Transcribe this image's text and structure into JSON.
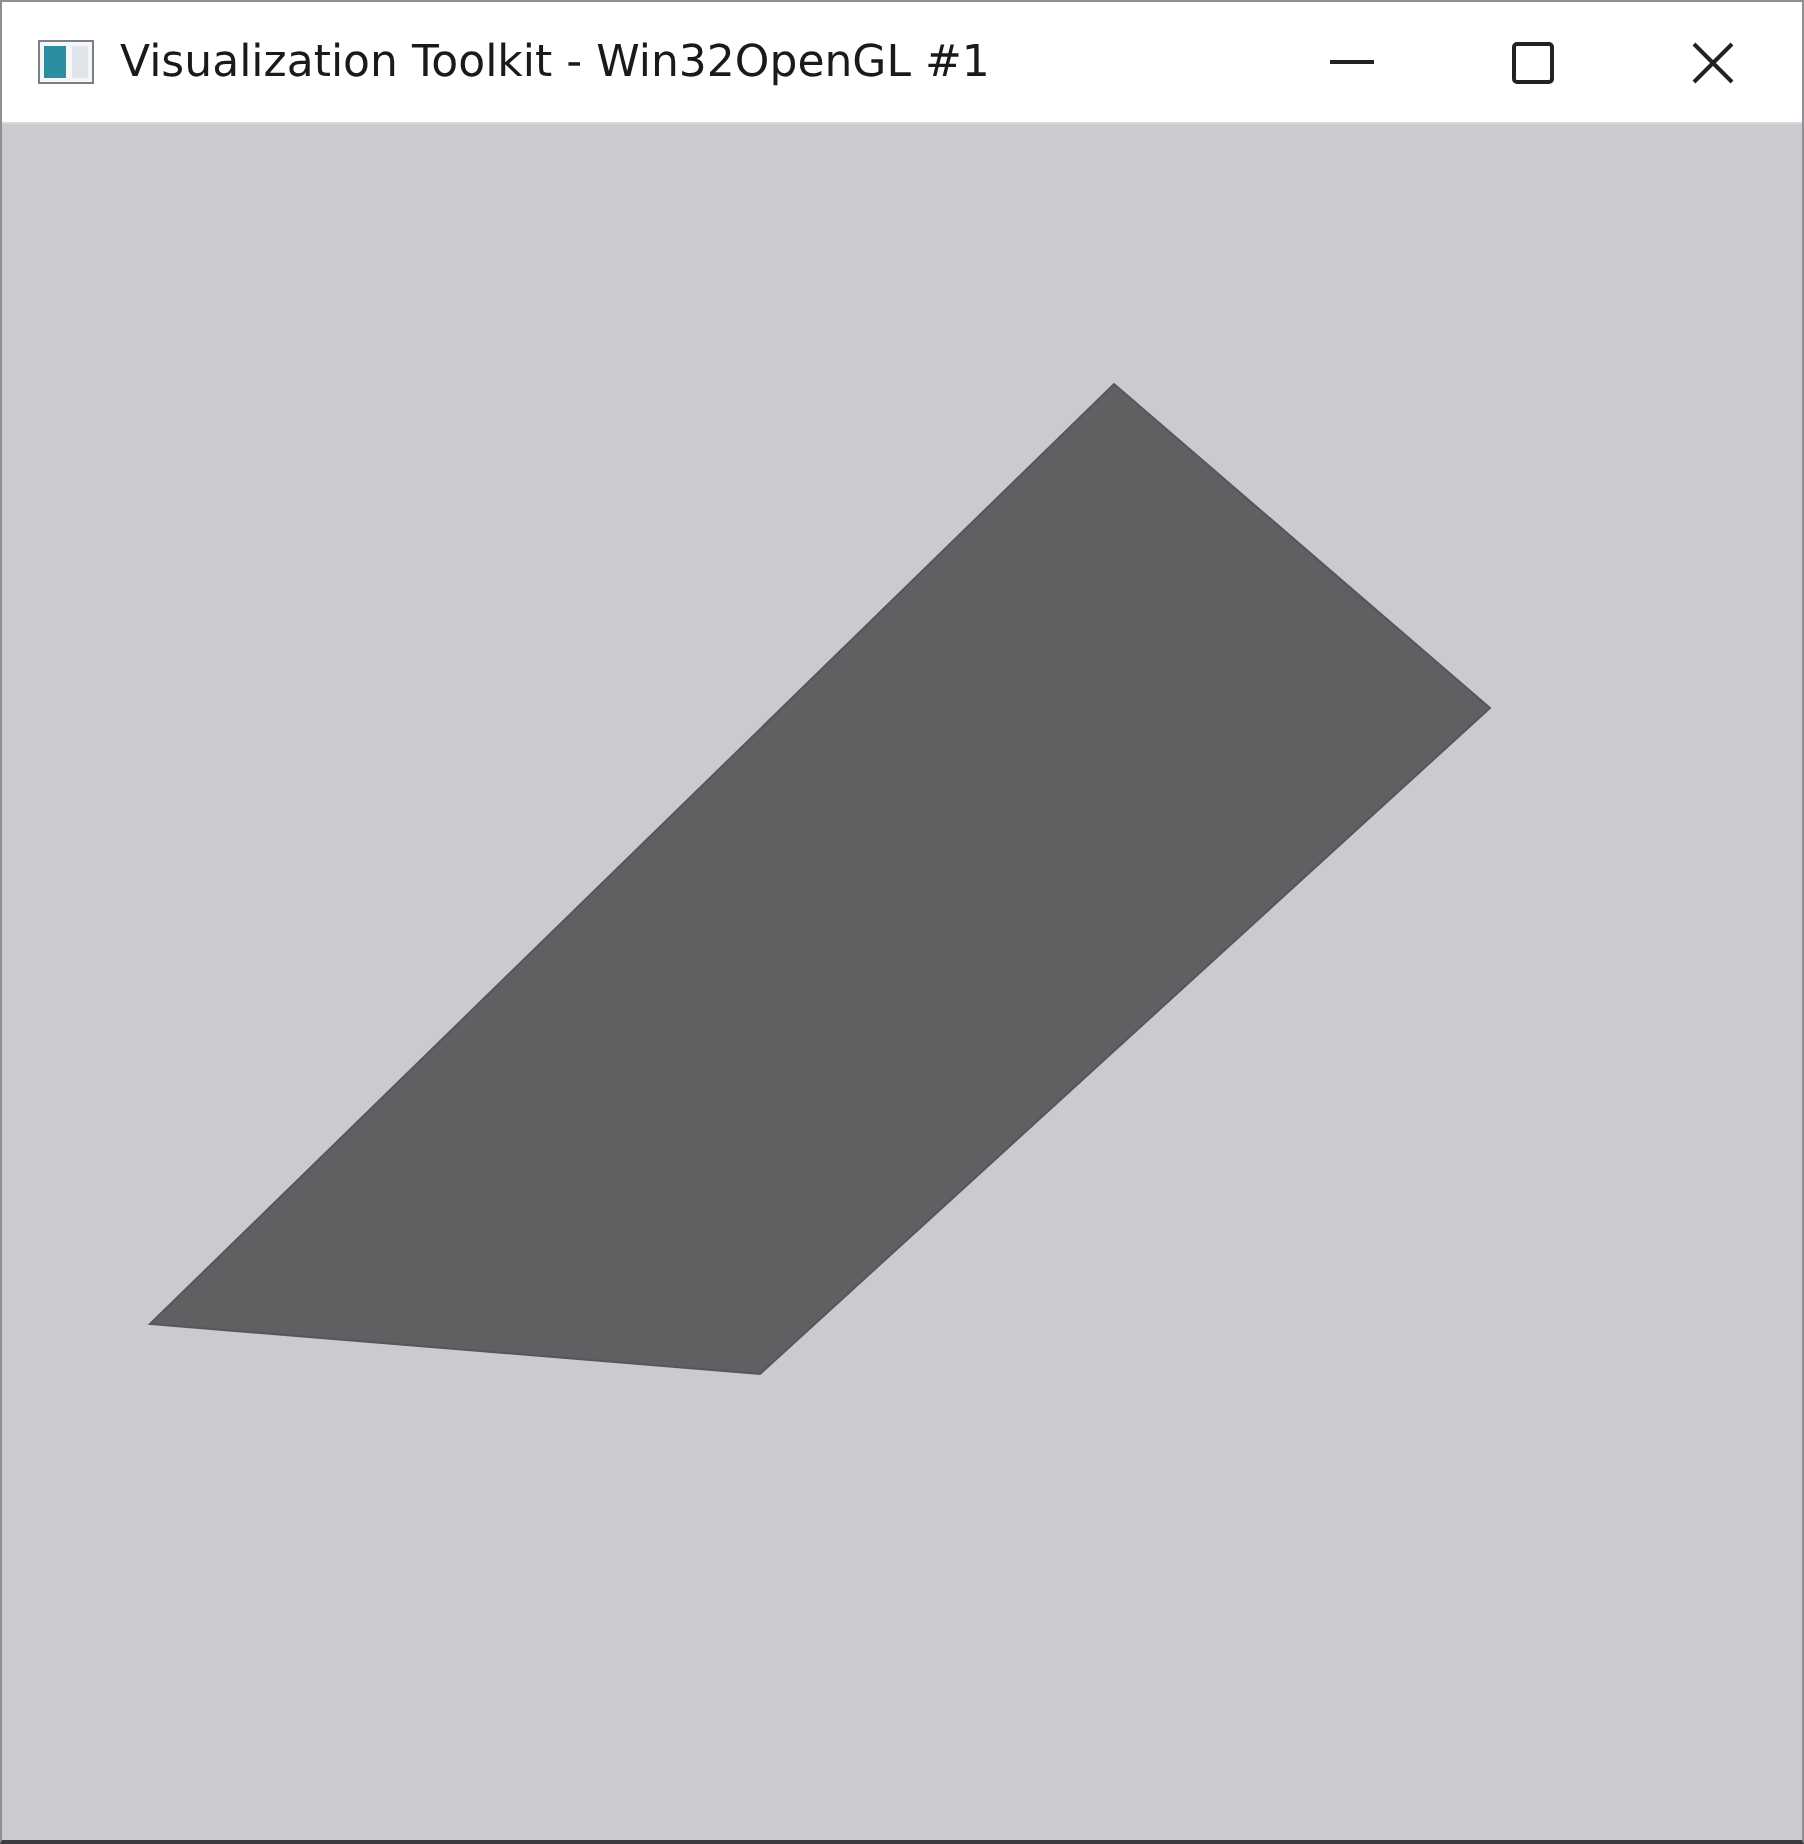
{
  "window": {
    "title": "Visualization Toolkit - Win32OpenGL #1"
  }
}
